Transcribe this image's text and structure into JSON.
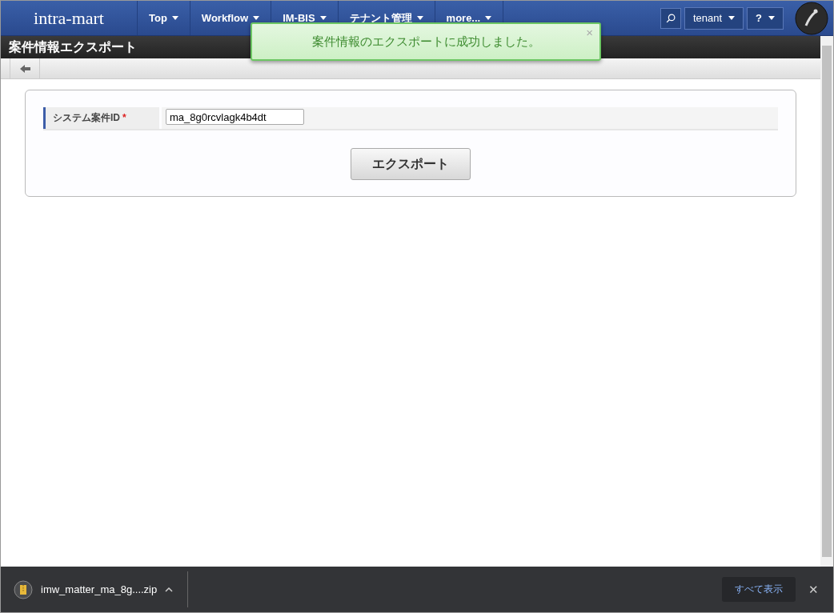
{
  "header": {
    "logo": "intra-mart",
    "menus": [
      {
        "label": "Top"
      },
      {
        "label": "Workflow"
      },
      {
        "label": "IM-BIS"
      },
      {
        "label": "テナント管理"
      },
      {
        "label": "more..."
      }
    ],
    "user": "tenant",
    "help": "?"
  },
  "toast": {
    "message": "案件情報のエクスポートに成功しました。",
    "close": "×"
  },
  "page_title": "案件情報エクスポート",
  "form": {
    "label": "システム案件ID",
    "required_mark": "*",
    "value": "ma_8g0rcvlagk4b4dt",
    "button": "エクスポート"
  },
  "download_bar": {
    "file": "imw_matter_ma_8g....zip",
    "show_all": "すべて表示",
    "close": "✕"
  }
}
